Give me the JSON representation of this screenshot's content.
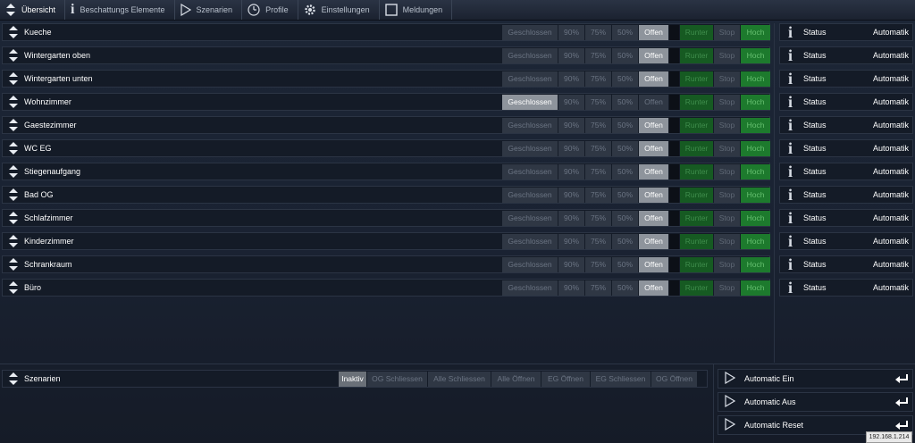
{
  "nav": [
    {
      "label": "Übersicht",
      "icon": "up-down-arrows-icon",
      "active": true
    },
    {
      "label": "Beschattungs Elemente",
      "icon": "info-icon",
      "active": false
    },
    {
      "label": "Szenarien",
      "icon": "play-icon",
      "active": false
    },
    {
      "label": "Profile",
      "icon": "clock-icon",
      "active": false
    },
    {
      "label": "Einstellungen",
      "icon": "gear-icon",
      "active": false
    },
    {
      "label": "Meldungen",
      "icon": "square-icon",
      "active": false
    }
  ],
  "button_labels": {
    "closed": "Geschlossen",
    "p90": "90%",
    "p75": "75%",
    "p50": "50%",
    "open": "Offen",
    "down": "Runter",
    "stop": "Stop",
    "up": "Hoch"
  },
  "rooms": [
    {
      "name": "Kueche",
      "selected": "open"
    },
    {
      "name": "Wintergarten oben",
      "selected": "open"
    },
    {
      "name": "Wintergarten unten",
      "selected": "open"
    },
    {
      "name": "Wohnzimmer",
      "selected": "closed"
    },
    {
      "name": "Gaestezimmer",
      "selected": "open"
    },
    {
      "name": "WC EG",
      "selected": "open"
    },
    {
      "name": "Stiegenaufgang",
      "selected": "open"
    },
    {
      "name": "Bad OG",
      "selected": "open"
    },
    {
      "name": "Schlafzimmer",
      "selected": "open"
    },
    {
      "name": "Kinderzimmer",
      "selected": "open"
    },
    {
      "name": "Schrankraum",
      "selected": "open"
    },
    {
      "name": "Büro",
      "selected": "open"
    }
  ],
  "status": {
    "label": "Status",
    "value": "Automatik"
  },
  "scenarios": {
    "title": "Szenarien",
    "buttons": [
      "Inaktiv",
      "OG Schliessen",
      "Alle Schliessen",
      "Alle Öffnen",
      "EG Öffnen",
      "EG Schliessen",
      "OG Öffnen"
    ],
    "active_index": 0
  },
  "automatic": [
    "Automatic Ein",
    "Automatic Aus",
    "Automatic Reset"
  ],
  "ip": "192.168.1.214",
  "colors": {
    "accent_green": "#1d7a2d",
    "selected_gray": "#8e949c",
    "background": "#1a2232"
  }
}
